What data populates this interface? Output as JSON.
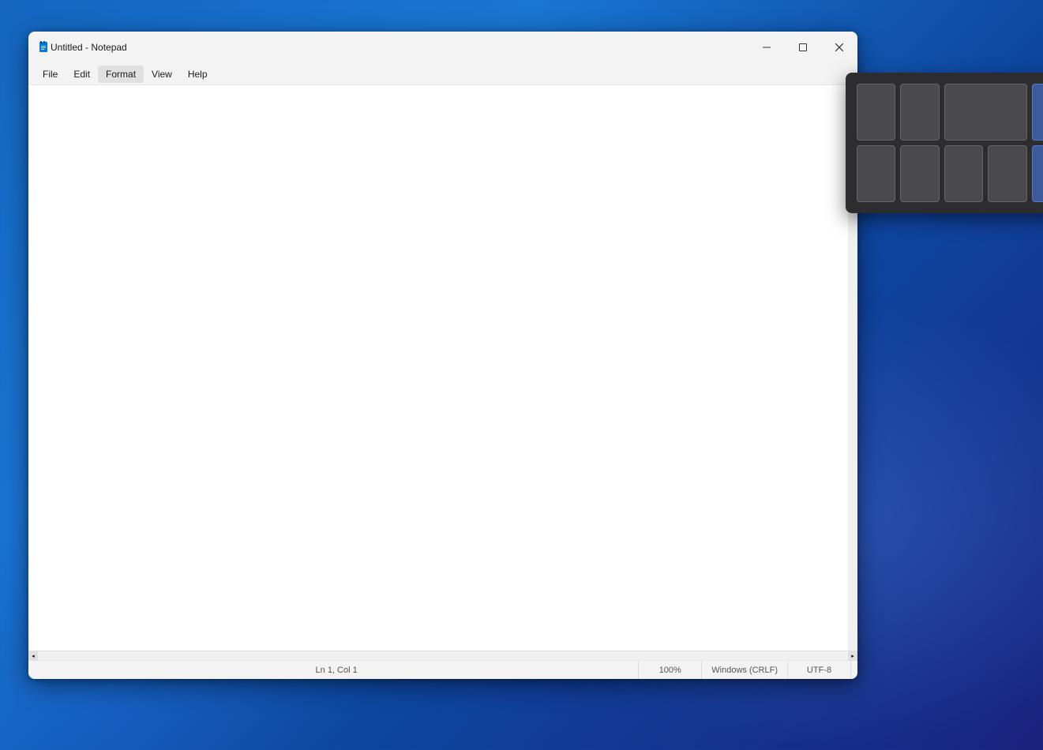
{
  "window": {
    "title": "Untitled - Notepad",
    "icon_label": "notepad"
  },
  "title_controls": {
    "minimize_label": "−",
    "maximize_label": "□",
    "close_label": "✕"
  },
  "menu": {
    "items": [
      "File",
      "Edit",
      "Format",
      "View",
      "Help"
    ]
  },
  "editor": {
    "content": "",
    "placeholder": ""
  },
  "status_bar": {
    "position": "Ln 1, Col 1",
    "zoom": "100%",
    "line_ending": "Windows (CRLF)",
    "encoding": "UTF-8"
  },
  "fancy_zones": {
    "cells_row1": [
      {
        "id": "r1c1",
        "type": "gray"
      },
      {
        "id": "r1c2",
        "type": "gray"
      },
      {
        "id": "r1c3",
        "type": "gray-wide"
      },
      {
        "id": "r1c4",
        "type": "gray"
      },
      {
        "id": "r1c5",
        "type": "blue"
      },
      {
        "id": "r1c6",
        "type": "blue-mid"
      },
      {
        "id": "r1c7",
        "type": "blue"
      }
    ],
    "cells_row2": [
      {
        "id": "r2c1",
        "type": "gray"
      },
      {
        "id": "r2c2",
        "type": "gray"
      },
      {
        "id": "r2c3",
        "type": "gray"
      },
      {
        "id": "r2c4",
        "type": "gray"
      },
      {
        "id": "r2c5",
        "type": "blue"
      },
      {
        "id": "r2c6",
        "type": "blue-mid"
      },
      {
        "id": "r2c7",
        "type": "blue"
      }
    ]
  }
}
